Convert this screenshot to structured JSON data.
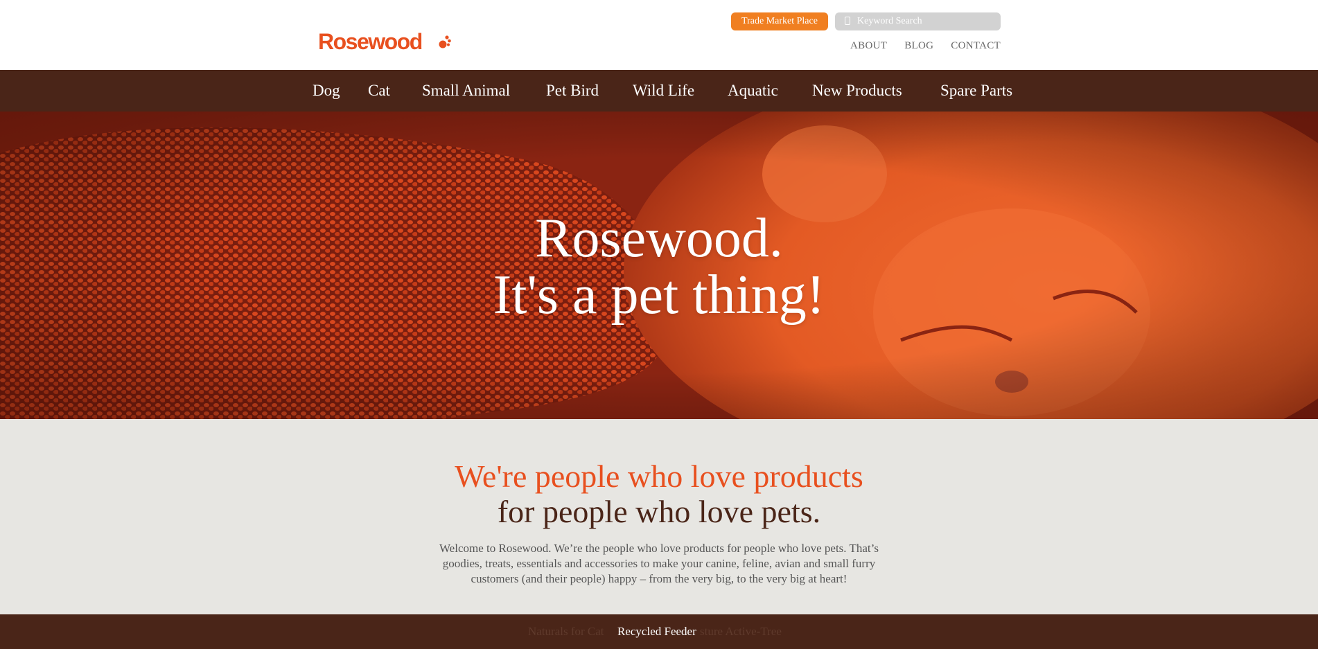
{
  "header": {
    "logo_text": "Rosewood",
    "trade_button": "Trade Market Place",
    "search_placeholder": "Keyword Search",
    "links": [
      "ABOUT",
      "BLOG",
      "CONTACT"
    ]
  },
  "nav": {
    "items": [
      "Dog",
      "Cat",
      "Small Animal",
      "Pet Bird",
      "Wild Life",
      "Aquatic",
      "New Products",
      "Spare Parts"
    ]
  },
  "hero": {
    "line1": "Rosewood.",
    "line2": "It's a pet thing!"
  },
  "intro": {
    "heading_line1": "We're people who love products",
    "heading_line2": "for people who love pets.",
    "body": "Welcome to Rosewood. We’re the people who love products for people who love pets. That’s goodies, treats, essentials and accessories to make your canine, feline, avian and small furry customers (and their people) happy – from the very big, to the very big at heart!"
  },
  "carousel": {
    "prev_label": "Naturals for Cat",
    "active_label": "Recycled Feeder",
    "next_label": "sture Active-Tree"
  },
  "colors": {
    "brand_orange": "#e8501f",
    "button_orange": "#f07f21",
    "dark_brown": "#4a2518",
    "intro_bg": "#e7e6e2"
  }
}
